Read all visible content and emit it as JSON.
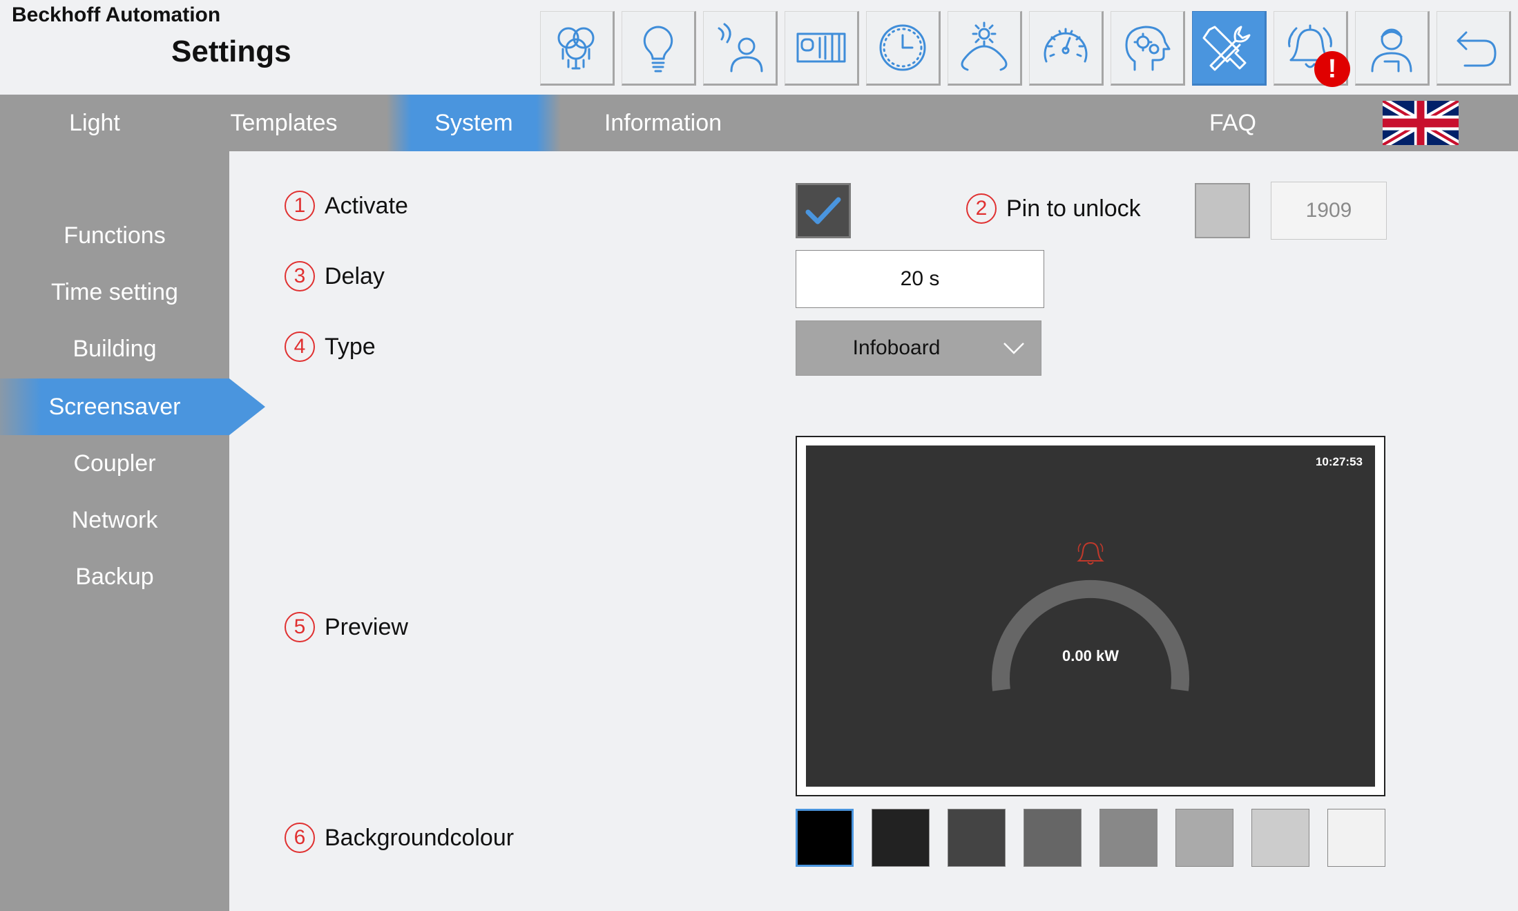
{
  "header": {
    "company": "Beckhoff Automation",
    "title": "Settings",
    "toolbar": [
      {
        "name": "lighting-group-icon",
        "active": false
      },
      {
        "name": "light-bulb-icon",
        "active": false
      },
      {
        "name": "presence-detector-icon",
        "active": false
      },
      {
        "name": "blinds-icon",
        "active": false
      },
      {
        "name": "clock-icon",
        "active": false
      },
      {
        "name": "daylight-icon",
        "active": false
      },
      {
        "name": "energy-meter-icon",
        "active": false
      },
      {
        "name": "head-gears-icon",
        "active": false
      },
      {
        "name": "tools-icon",
        "active": true
      },
      {
        "name": "alarm-bell-icon",
        "active": false
      },
      {
        "name": "user-icon",
        "active": false
      },
      {
        "name": "back-arrow-icon",
        "active": false
      }
    ],
    "alarm_badge": "!"
  },
  "topnav": {
    "items": [
      {
        "label": "Light",
        "active": false
      },
      {
        "label": "Templates",
        "active": false
      },
      {
        "label": "System",
        "active": true
      },
      {
        "label": "Information",
        "active": false
      },
      {
        "label": "FAQ",
        "active": false
      }
    ],
    "language": "uk-flag-icon"
  },
  "sidebar": {
    "items": [
      {
        "label": "Functions",
        "active": false
      },
      {
        "label": "Time setting",
        "active": false
      },
      {
        "label": "Building",
        "active": false
      },
      {
        "label": "Screensaver",
        "active": true
      },
      {
        "label": "Coupler",
        "active": false
      },
      {
        "label": "Network",
        "active": false
      },
      {
        "label": "Backup",
        "active": false
      }
    ]
  },
  "screensaver": {
    "activate": {
      "num": "1",
      "label": "Activate",
      "checked": true
    },
    "pin": {
      "num": "2",
      "label": "Pin to unlock",
      "enabled": false,
      "value": "1909"
    },
    "delay": {
      "num": "3",
      "label": "Delay",
      "value": "20 s"
    },
    "type": {
      "num": "4",
      "label": "Type",
      "value": "Infoboard"
    },
    "preview": {
      "num": "5",
      "label": "Preview",
      "time": "10:27:53",
      "value": "0.00 kW"
    },
    "background": {
      "num": "6",
      "label": "Backgroundcolour",
      "colors": [
        "#000000",
        "#222222",
        "#444444",
        "#666666",
        "#888888",
        "#aaaaaa",
        "#cccccc",
        "#f2f2f2"
      ],
      "selected": 0
    }
  },
  "colors": {
    "accent": "#4a95de",
    "alarm": "#e00000",
    "nav": "#9a9a9a"
  }
}
